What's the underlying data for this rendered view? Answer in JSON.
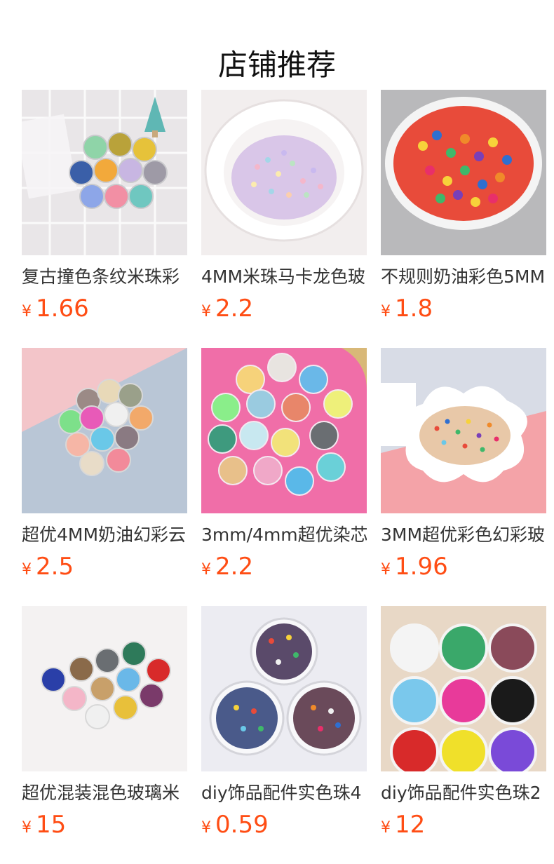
{
  "section": {
    "title": "店铺推荐"
  },
  "currency_symbol": "¥",
  "products": [
    {
      "name": "复古撞色条纹米珠彩",
      "price": "1.66",
      "image": "product-photo-seed-beads-jars-with-tree"
    },
    {
      "name": "4MM米珠马卡龙色玻",
      "price": "2.2",
      "image": "product-photo-pastel-beads-plate"
    },
    {
      "name": "不规则奶油彩色5MM",
      "price": "1.8",
      "image": "product-photo-colorful-beads-bowl"
    },
    {
      "name": "超优4MM奶油幻彩云",
      "price": "2.5",
      "image": "product-photo-bead-jars-pastel-bg"
    },
    {
      "name": "3mm/4mm超优染芯",
      "price": "2.2",
      "image": "product-photo-bead-jars-pink-bg"
    },
    {
      "name": "3MM超优彩色幻彩玻",
      "price": "1.96",
      "image": "product-photo-beads-flower-plate"
    },
    {
      "name": "超优混装混色玻璃米",
      "price": "15",
      "image": "product-photo-mixed-bead-jars"
    },
    {
      "name": "diy饰品配件实色珠4",
      "price": "0.59",
      "image": "product-photo-three-bead-dishes"
    },
    {
      "name": "diy饰品配件实色珠2",
      "price": "12",
      "image": "product-photo-nine-solid-bead-dishes"
    }
  ],
  "colors": {
    "price": "#ff4d14",
    "title": "#111111",
    "name": "#333333"
  }
}
